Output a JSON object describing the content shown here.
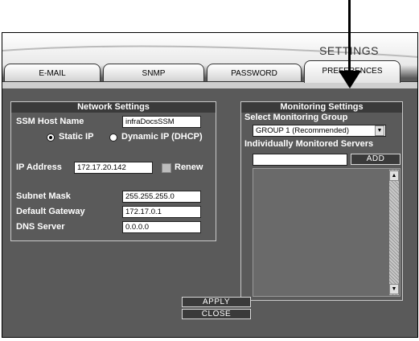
{
  "window": {
    "title": "SETTINGS"
  },
  "tabs": [
    {
      "label": "E-MAIL"
    },
    {
      "label": "SNMP"
    },
    {
      "label": "PASSWORD"
    },
    {
      "label": "PREFERENCES",
      "active": true
    }
  ],
  "network": {
    "title": "Network Settings",
    "host_label": "SSM Host Name",
    "host_value": "infraDocsSSM",
    "static_ip_label": "Static IP",
    "dynamic_ip_label": "Dynamic IP (DHCP)",
    "ip_mode": "static",
    "ip_label": "IP Address",
    "ip_value": "172.17.20.142",
    "renew_label": "Renew",
    "subnet_label": "Subnet Mask",
    "subnet_value": "255.255.255.0",
    "gateway_label": "Default Gateway",
    "gateway_value": "172.17.0.1",
    "dns_label": "DNS Server",
    "dns_value": "0.0.0.0"
  },
  "monitoring": {
    "title": "Monitoring Settings",
    "group_label": "Select Monitoring Group",
    "group_value": "GROUP 1 (Recommended)",
    "servers_label": "Individually Monitored Servers",
    "server_input": "",
    "add_label": "ADD"
  },
  "actions": {
    "apply_label": "APPLY",
    "close_label": "CLOSE"
  },
  "icons": {
    "callout": "down-arrow-icon",
    "dropdown": "triangle-down-icon",
    "scroll_up": "triangle-up-icon",
    "scroll_down": "triangle-down-icon"
  },
  "colors": {
    "panel_bg": "#5a5a5a",
    "header_bg": "#3a3a3a",
    "text": "#ffffff"
  }
}
